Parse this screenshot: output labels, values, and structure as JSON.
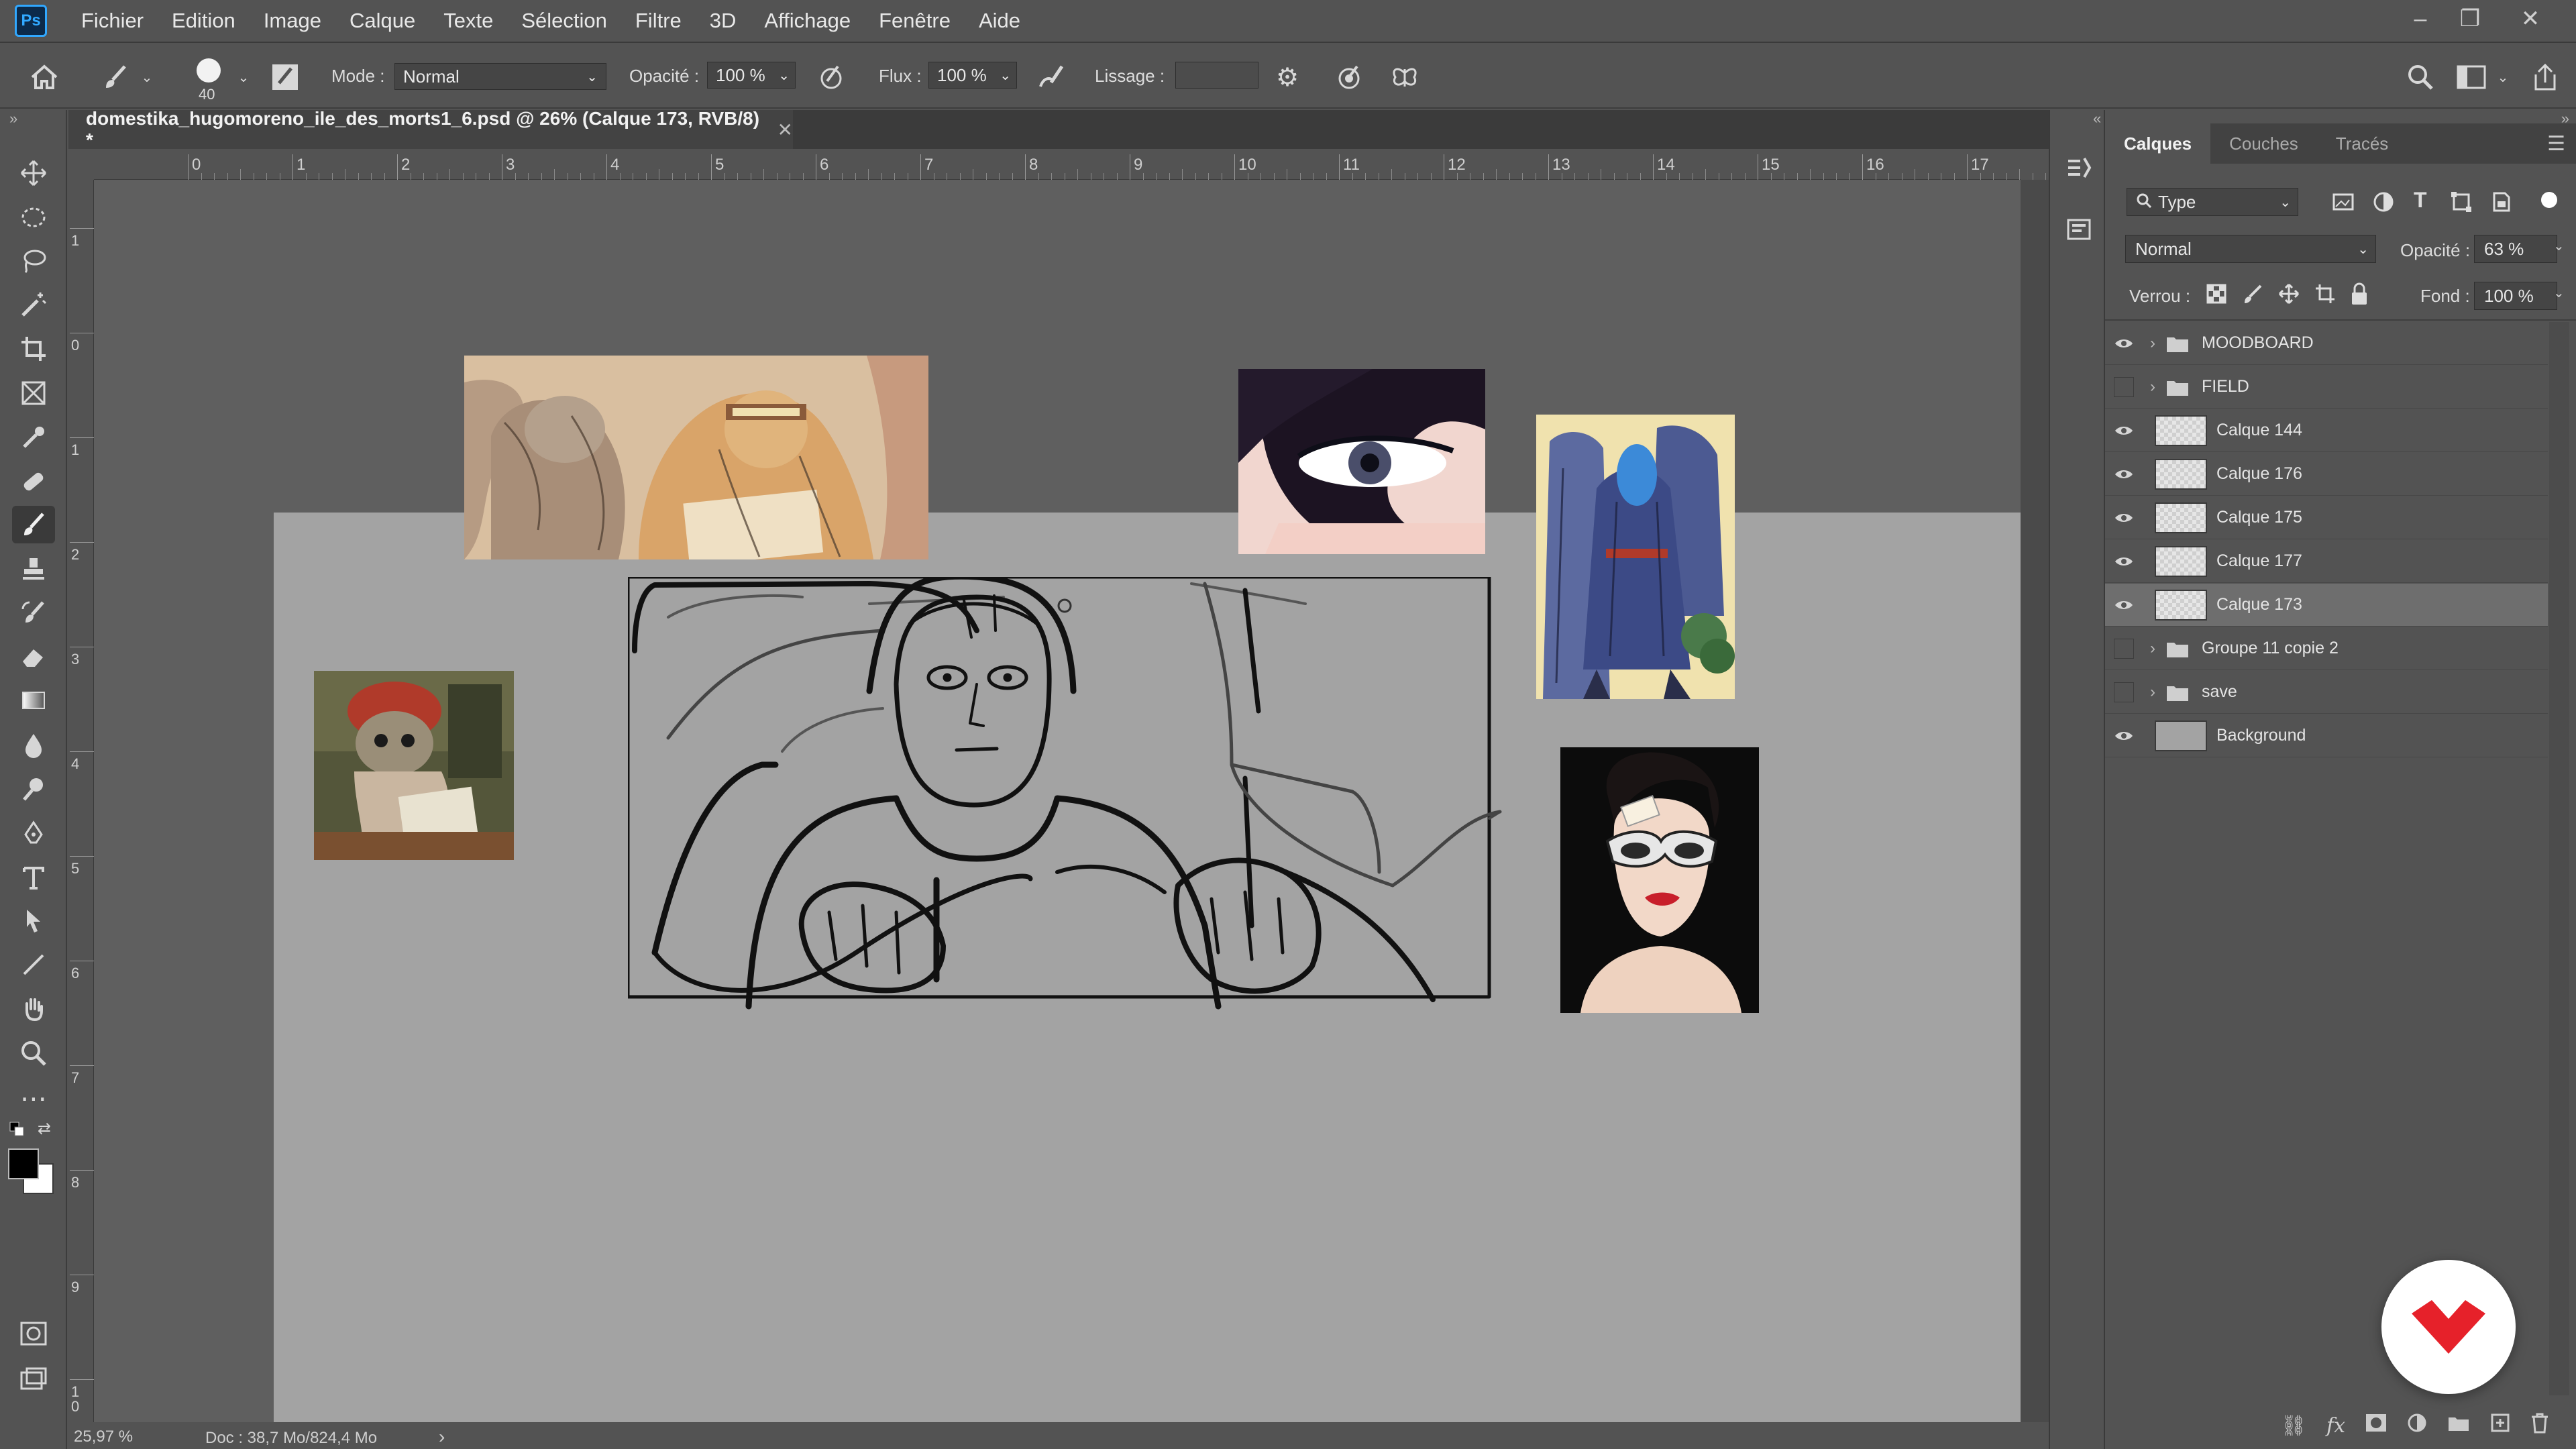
{
  "app": {
    "logo": "Ps"
  },
  "menu": [
    "Fichier",
    "Edition",
    "Image",
    "Calque",
    "Texte",
    "Sélection",
    "Filtre",
    "3D",
    "Affichage",
    "Fenêtre",
    "Aide"
  ],
  "window_controls": {
    "minimize": "–",
    "restore": "❐",
    "close": "✕"
  },
  "options": {
    "brush_size": "40",
    "mode_label": "Mode :",
    "mode_value": "Normal",
    "opacity_label": "Opacité :",
    "opacity_value": "100 %",
    "flux_label": "Flux :",
    "flux_value": "100 %",
    "smoothing_label": "Lissage :",
    "smoothing_value": ""
  },
  "document": {
    "tab_title": "domestika_hugomoreno_ile_des_morts1_6.psd @ 26% (Calque 173, RVB/8) *",
    "close": "✕"
  },
  "rulers": {
    "h_ticks": [
      "0",
      "1",
      "2",
      "3",
      "4",
      "5",
      "6",
      "7",
      "8",
      "9",
      "10",
      "11",
      "12",
      "13",
      "14",
      "15",
      "16",
      "17"
    ],
    "v_ticks": [
      "1",
      "0",
      "1",
      "2",
      "3",
      "4",
      "5",
      "6",
      "7",
      "8",
      "9",
      "1\n0"
    ]
  },
  "status": {
    "zoom": "25,97 %",
    "doc_info": "Doc : 38,7 Mo/824,4 Mo",
    "arrow": "›"
  },
  "panel": {
    "tabs": [
      "Calques",
      "Couches",
      "Tracés"
    ],
    "filter_value": "Type",
    "blend_mode": "Normal",
    "opacity_label": "Opacité :",
    "opacity_value": "63 %",
    "lock_label": "Verrou :",
    "fill_label": "Fond :",
    "fill_value": "100 %",
    "layers": [
      {
        "name": "MOODBOARD",
        "type": "group",
        "visible": true
      },
      {
        "name": "FIELD",
        "type": "group",
        "visible": false
      },
      {
        "name": "Calque 144",
        "type": "layer",
        "visible": true
      },
      {
        "name": "Calque 176",
        "type": "layer",
        "visible": true
      },
      {
        "name": "Calque 175",
        "type": "layer",
        "visible": true
      },
      {
        "name": "Calque 177",
        "type": "layer",
        "visible": true
      },
      {
        "name": "Calque 173",
        "type": "layer",
        "visible": true,
        "selected": true
      },
      {
        "name": "Groupe 11 copie 2",
        "type": "group",
        "visible": false
      },
      {
        "name": "save",
        "type": "group",
        "visible": false
      },
      {
        "name": "Background",
        "type": "layer",
        "visible": true
      }
    ]
  },
  "colors": {
    "accent": "#31a8ff",
    "domestika_red": "#e6212a",
    "foreground": "#000000",
    "background": "#ffffff"
  }
}
